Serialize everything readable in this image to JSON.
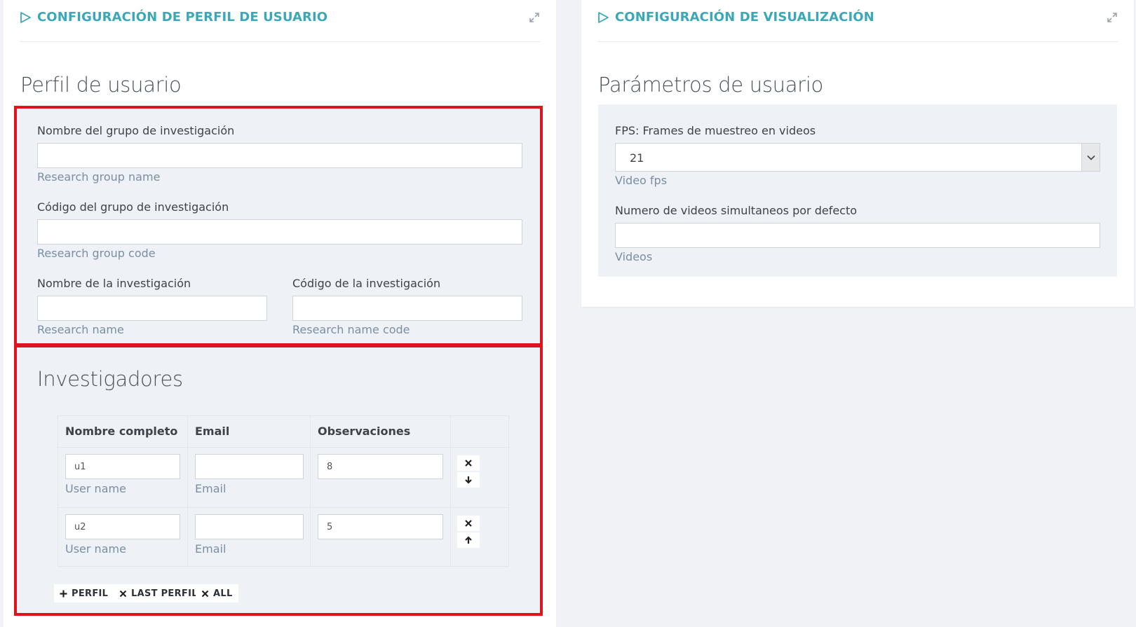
{
  "left_panel": {
    "title": "CONFIGURACIÓN DE PERFIL DE USUARIO",
    "heading": "Perfil de usuario",
    "fields": {
      "group_name": {
        "label": "Nombre del grupo de investigación",
        "value": "",
        "help": "Research group name"
      },
      "group_code": {
        "label": "Código del grupo de investigación",
        "value": "",
        "help": "Research group code"
      },
      "research_name": {
        "label": "Nombre de la investigación",
        "value": "",
        "help": "Research name"
      },
      "research_code": {
        "label": "Código de la investigación",
        "value": "",
        "help": "Research name code"
      }
    },
    "researchers": {
      "heading": "Investigadores",
      "columns": [
        "Nombre completo",
        "Email",
        "Observaciones"
      ],
      "rows": [
        {
          "name": "u1",
          "name_help": "User name",
          "email": "",
          "email_help": "Email",
          "notes": "8",
          "move_icon": "arrow-down-icon"
        },
        {
          "name": "u2",
          "name_help": "User name",
          "email": "",
          "email_help": "Email",
          "notes": "5",
          "move_icon": "arrow-up-icon"
        }
      ],
      "buttons": {
        "add": "PERFIL",
        "remove_last": "LAST PERFIL",
        "remove_all": "ALL"
      }
    }
  },
  "right_panel": {
    "title": "CONFIGURACIÓN DE VISUALIZACIÓN",
    "heading": "Parámetros de usuario",
    "fps": {
      "label": "FPS: Frames de muestreo en videos",
      "value": "21",
      "help": "Video fps"
    },
    "videos": {
      "label": "Numero de videos simultaneos por defecto",
      "value": "",
      "help": "Videos"
    }
  },
  "colors": {
    "accent": "#3aa8b8",
    "highlight_border": "#e0121b",
    "help_text": "#7a8ea4",
    "well_bg": "#eef1f5"
  },
  "icons": {
    "title_icon": "play-outline-icon",
    "expand_icon": "expand-arrows-icon",
    "remove_icon": "x-icon",
    "add_icon": "plus-icon",
    "select_icon": "chevron-down-icon"
  }
}
